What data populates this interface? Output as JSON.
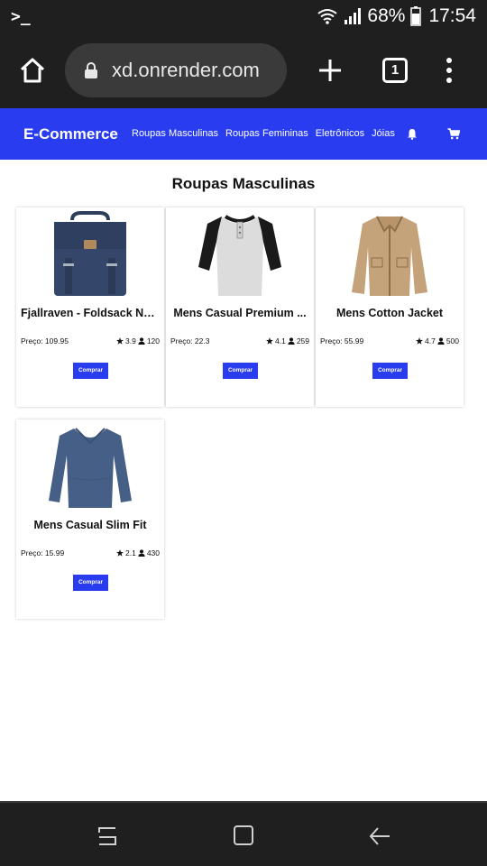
{
  "status_bar": {
    "battery": "68%",
    "time": "17:54"
  },
  "browser": {
    "url": "xd.onrender.com",
    "tab_count": "1"
  },
  "navbar": {
    "brand": "E-Commerce",
    "links": [
      "Roupas Masculinas",
      "Roupas Femininas",
      "Eletrônicos",
      "Jóias"
    ]
  },
  "page": {
    "title": "Roupas Masculinas"
  },
  "products": [
    {
      "name": "Fjallraven - Foldsack No...",
      "price": "Preço: 109.95",
      "rating": "3.9",
      "count": "120",
      "button": "Comprar"
    },
    {
      "name": "Mens Casual Premium ...",
      "price": "Preço: 22.3",
      "rating": "4.1",
      "count": "259",
      "button": "Comprar"
    },
    {
      "name": "Mens Cotton Jacket",
      "price": "Preço: 55.99",
      "rating": "4.7",
      "count": "500",
      "button": "Comprar"
    },
    {
      "name": "Mens Casual Slim Fit",
      "price": "Preço: 15.99",
      "rating": "2.1",
      "count": "430",
      "button": "Comprar"
    }
  ],
  "colors": {
    "accent": "#2a3cf0",
    "system_bar": "#1f1f1f"
  }
}
